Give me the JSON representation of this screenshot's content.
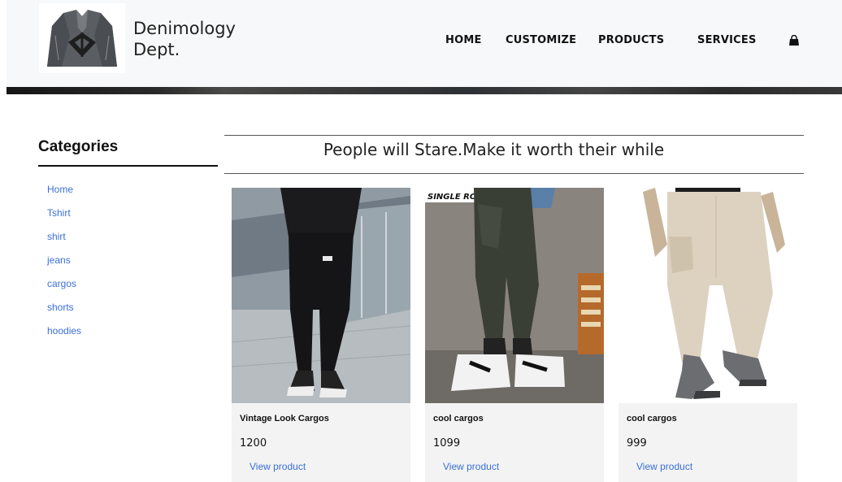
{
  "header": {
    "brand_line1": "Denimology",
    "brand_line2": "Dept.",
    "nav": {
      "home": "HOME",
      "customize": "CUSTOMIZE",
      "products": "PRODUCTS",
      "services": "SERVICES"
    },
    "cart_icon": "shopping-bag-icon"
  },
  "sidebar": {
    "title": "Categories",
    "items": [
      "Home",
      "Tshirt",
      "shirt",
      "jeans",
      "cargos",
      "shorts",
      "hoodies"
    ]
  },
  "main": {
    "tagline": "People will Stare.Make it worth their while",
    "products": [
      {
        "name": "Vintage Look Cargos",
        "price": "1200",
        "link": "View product"
      },
      {
        "name": "cool cargos",
        "price": "1099",
        "link": "View product",
        "image_text": "SINGLE ROAD"
      },
      {
        "name": "cool cargos",
        "price": "999",
        "link": "View product"
      }
    ]
  },
  "colors": {
    "header_bg": "#f7f8f9",
    "link": "#3a6fd8",
    "card_bg": "#f3f3f3"
  }
}
